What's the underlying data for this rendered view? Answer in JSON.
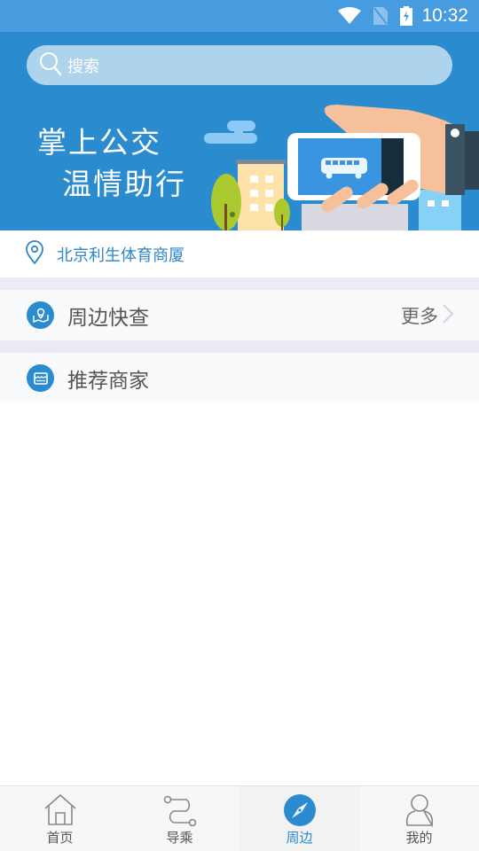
{
  "status_bar": {
    "time": "10:32",
    "icons": [
      "wifi-icon",
      "no-sim-icon",
      "battery-charging-icon"
    ]
  },
  "header": {
    "search": {
      "placeholder": "搜索",
      "icon": "search-icon"
    },
    "banner": {
      "slogan_line1": "掌上公交",
      "slogan_line2": "温情助行"
    }
  },
  "location": {
    "icon": "location-pin-icon",
    "text": "北京利生体育商厦"
  },
  "sections": [
    {
      "title": "周边快查",
      "icon": "map-pin-icon",
      "more_label": "更多"
    },
    {
      "title": "推荐商家",
      "icon": "store-icon"
    }
  ],
  "colors": {
    "primary": "#2b8bcf",
    "status_bar": "#479ce0",
    "separator": "#ebebf4"
  },
  "bottom_nav": {
    "active_index": 2,
    "items": [
      {
        "label": "首页",
        "icon": "home-icon"
      },
      {
        "label": "导乘",
        "icon": "route-icon"
      },
      {
        "label": "周边",
        "icon": "compass-icon"
      },
      {
        "label": "我的",
        "icon": "user-icon"
      }
    ]
  }
}
